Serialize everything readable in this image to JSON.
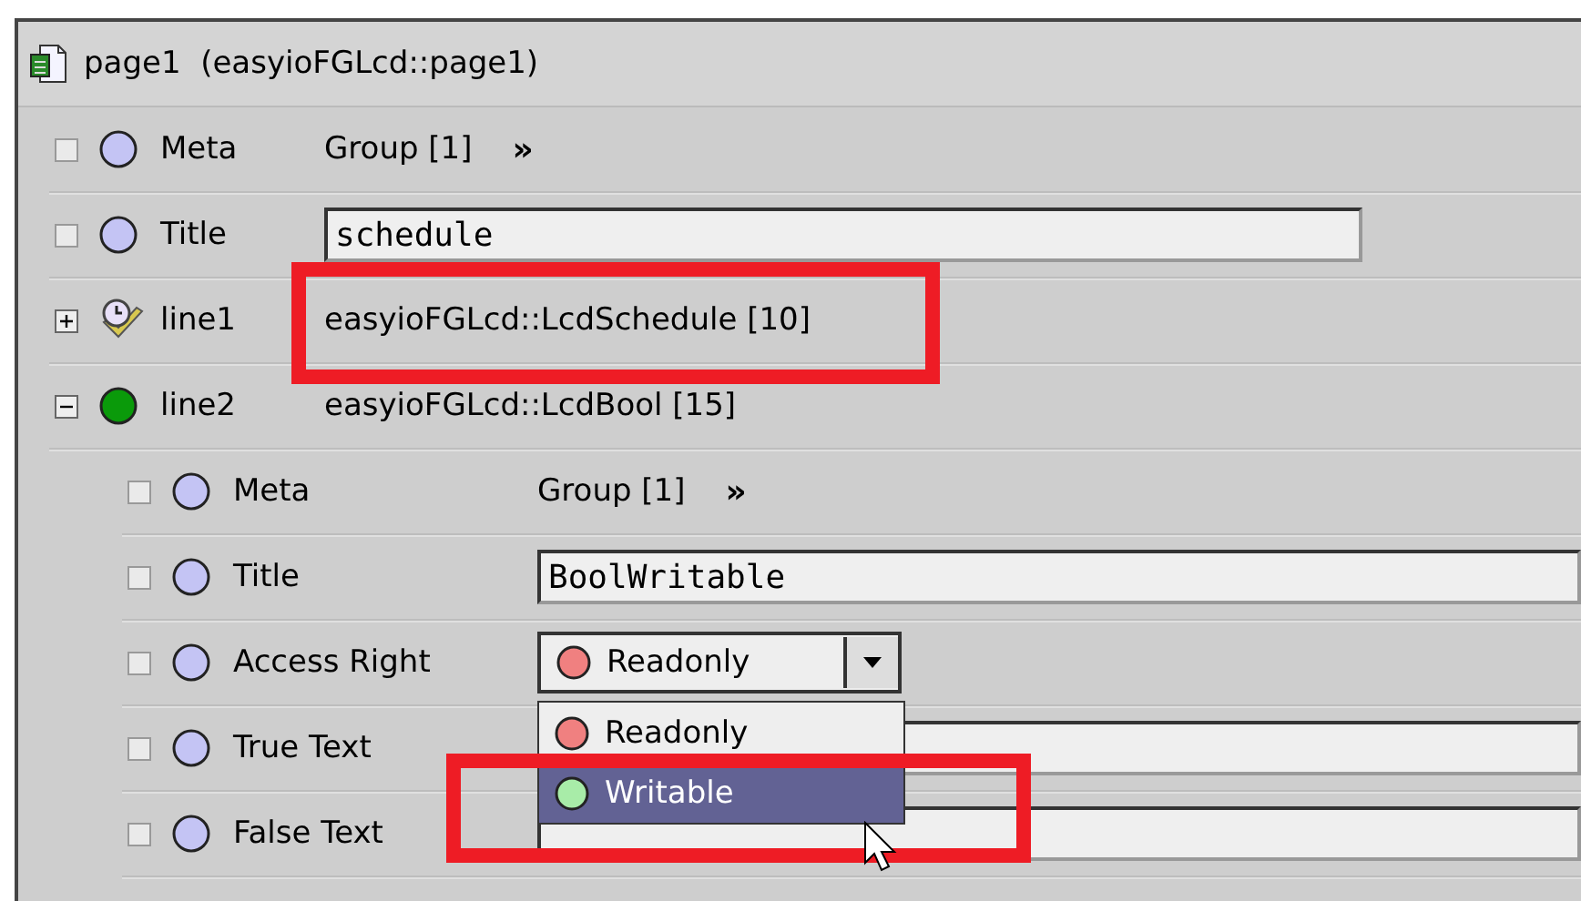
{
  "header": {
    "title": "page1  (easyioFGLcd::page1)"
  },
  "rows": [
    {
      "kind": "group",
      "checked": false,
      "color": "#c4c4f4",
      "label": "Meta",
      "value": "Group [1]",
      "action": "»"
    },
    {
      "kind": "text-field",
      "checked": false,
      "color": "#c4c4f4",
      "label": "Title",
      "value": "schedule"
    },
    {
      "kind": "type",
      "expanded": false,
      "label": "line1",
      "value": "easyioFGLcd::LcdSchedule [10]"
    },
    {
      "kind": "type",
      "color": "#0a9a0a",
      "expanded": true,
      "label": "line2",
      "value": "easyioFGLcd::LcdBool [15]",
      "children": [
        {
          "kind": "group",
          "checked": false,
          "color": "#c4c4f4",
          "label": "Meta",
          "value": "Group [1]",
          "action": "»"
        },
        {
          "kind": "text-field",
          "checked": false,
          "color": "#c4c4f4",
          "label": "Title",
          "value": "BoolWritable"
        },
        {
          "kind": "enum",
          "checked": false,
          "color": "#c4c4f4",
          "label": "Access Right",
          "value": {
            "text": "Readonly",
            "color": "#f08080"
          },
          "open": true,
          "options": [
            {
              "label": "Readonly",
              "color": "#f08080",
              "selected": false
            },
            {
              "label": "Writable",
              "color": "#a8eca8",
              "selected": true
            }
          ]
        },
        {
          "kind": "text-field",
          "checked": false,
          "color": "#c4c4f4",
          "label": "True Text"
        },
        {
          "kind": "text-field",
          "checked": false,
          "color": "#c4c4f4",
          "label": "False Text"
        }
      ]
    }
  ]
}
